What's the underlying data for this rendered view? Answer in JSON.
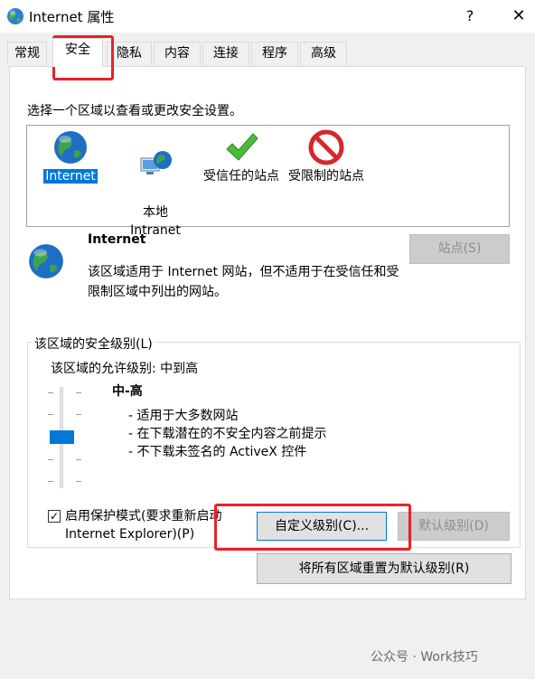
{
  "window": {
    "title": "Internet 属性",
    "help_label": "?",
    "close_label": "✕",
    "icon": "internet-globe-icon"
  },
  "tabs": [
    {
      "label": "常规",
      "active": false
    },
    {
      "label": "安全",
      "active": true
    },
    {
      "label": "隐私",
      "active": false
    },
    {
      "label": "内容",
      "active": false
    },
    {
      "label": "连接",
      "active": false
    },
    {
      "label": "程序",
      "active": false
    },
    {
      "label": "高级",
      "active": false
    }
  ],
  "security": {
    "instruction": "选择一个区域以查看或更改安全设置。",
    "zones": [
      {
        "label": "Internet",
        "icon": "globe-icon",
        "selected": true
      },
      {
        "label": "本地\nIntranet",
        "icon": "local-intranet-icon",
        "selected": false
      },
      {
        "label": "受信任的站点",
        "icon": "checkmark-icon",
        "selected": false
      },
      {
        "label": "受限制的站点",
        "icon": "restricted-icon",
        "selected": false
      }
    ],
    "detail": {
      "title": "Internet",
      "description": "该区域适用于 Internet 网站，但不适用于在受信任和受限制区域中列出的网站。",
      "sites_button": "站点(S)"
    },
    "level_group": {
      "legend": "该区域的安全级别(L)",
      "allowed": "该区域的允许级别: 中到高",
      "level_name": "中-高",
      "level_items": [
        "- 适用于大多数网站",
        "- 在下载潜在的不安全内容之前提示",
        "- 不下载未签名的 ActiveX 控件"
      ],
      "slider_level": "中-高",
      "protected_mode_checked": true,
      "protected_mode_line1": "启用保护模式(要求重新启动",
      "protected_mode_line2": "Internet Explorer)(P)",
      "custom_level_button": "自定义级别(C)...",
      "default_level_button": "默认级别(D)"
    },
    "reset_all_button": "将所有区域重置为默认级别(R)"
  },
  "watermark": "公众号 · Work技巧",
  "colors": {
    "accent": "#0078d7",
    "highlight_box": "#e8212b",
    "panel_bg": "#ffffff",
    "window_bg": "#f0f0f0"
  }
}
